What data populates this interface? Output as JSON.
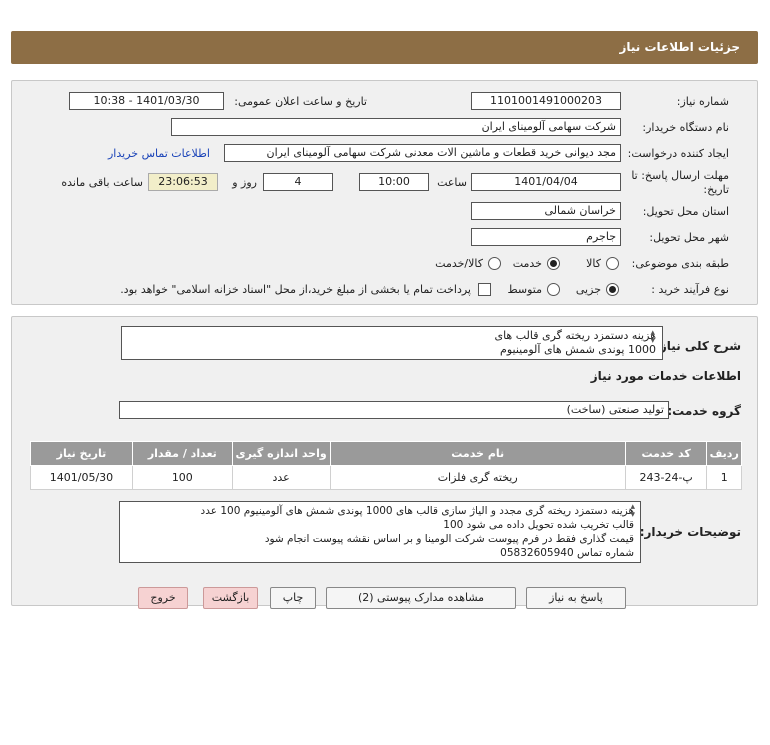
{
  "header": {
    "title": "جزئیات اطلاعات نیاز"
  },
  "form": {
    "need_number_label": "شماره نیاز:",
    "need_number": "1101001491000203",
    "announce_label": "تاریخ و ساعت اعلان عمومی:",
    "announce_value": "1401/03/30 - 10:38",
    "buyer_org_label": "نام دستگاه خریدار:",
    "buyer_org": "شرکت سهامی آلومینای ایران",
    "requester_label": "ایجاد کننده درخواست:",
    "requester": "مجد دیوانی خرید قطعات و ماشین الات معدنی شرکت سهامی آلومینای ایران",
    "contact_link": "اطلاعات تماس خریدار",
    "deadline_label_1": "مهلت ارسال پاسخ: تا",
    "deadline_label_2": "تاریخ:",
    "deadline_date": "1401/04/04",
    "time_label": "ساعت",
    "deadline_time": "10:00",
    "days_value": "4",
    "days_label": "روز و",
    "remaining_time": "23:06:53",
    "remaining_label": "ساعت باقی مانده",
    "province_label": "استان محل تحویل:",
    "province": "خراسان شمالی",
    "city_label": "شهر محل تحویل:",
    "city": "جاجرم",
    "category_label": "طبقه بندی موضوعی:",
    "category_options": [
      "کالا",
      "خدمت",
      "کالا/خدمت"
    ],
    "category_selected": 1,
    "purchase_type_label": "نوع فرآیند خرید :",
    "purchase_options": [
      "جزیی",
      "متوسط"
    ],
    "purchase_selected": 0,
    "treasury_text": "پرداخت تمام یا بخشی از مبلغ خرید،از محل \"اسناد خزانه اسلامی\" خواهد بود."
  },
  "details": {
    "summary_label": "شرح کلی نیاز:",
    "summary_lines": [
      "هزینه دستمزد ریخته گری قالب های",
      "1000 پوندی شمش های آلومینیوم"
    ],
    "services_heading": "اطلاعات خدمات مورد نیاز",
    "service_group_label": "گروه خدمت:",
    "service_group": "تولید صنعتی (ساخت)",
    "table": {
      "headers": [
        "ردیف",
        "کد خدمت",
        "نام خدمت",
        "واحد اندازه گیری",
        "تعداد / مقدار",
        "تاریخ نیاز"
      ],
      "rows": [
        [
          "1",
          "پ-24-243",
          "ریخته گری فلزات",
          "عدد",
          "100",
          "1401/05/30"
        ]
      ]
    },
    "buyer_notes_label": "توضیحات خریدار:",
    "buyer_notes_lines": [
      "هزینه دستمزد ریخته گری مجدد و الیاژ سازی قالب های 1000 پوندی شمش های آلومینیوم 100 عدد",
      "قالب تخریب شده تحویل داده می شود 100",
      "قیمت گذاری فقط در فرم پیوست شرکت الومینا و بر اساس نقشه پیوست انجام شود",
      "شماره تماس 05832605940"
    ]
  },
  "buttons": {
    "reply": "پاسخ به نیاز",
    "attachments": "مشاهده مدارک پیوستی (2)",
    "print": "چاپ",
    "back": "بازگشت",
    "exit": "خروج"
  }
}
